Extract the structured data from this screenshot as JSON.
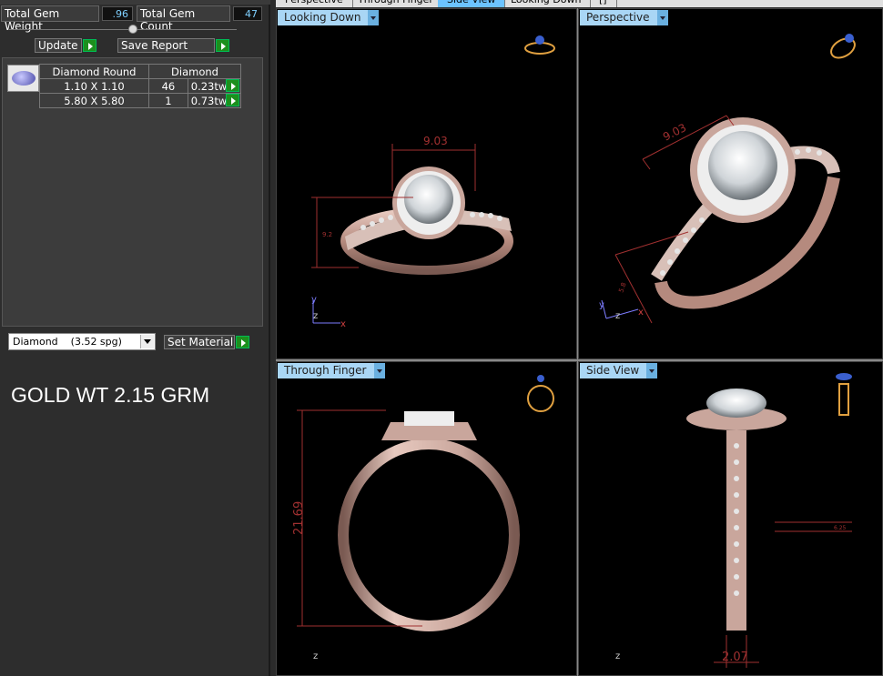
{
  "stats": {
    "total_gem_weight_label": "Total Gem Weight",
    "total_gem_weight_value": ".96",
    "total_gem_count_label": "Total Gem Count",
    "total_gem_count_value": "47"
  },
  "buttons": {
    "update": "Update",
    "save_report": "Save Report",
    "set_material": "Set Material"
  },
  "gem_table": {
    "headers": [
      "Diamond Round",
      "Diamond"
    ],
    "rows": [
      {
        "size": "1.10 X 1.10",
        "count": "46",
        "weight": "0.23tw"
      },
      {
        "size": "5.80 X 5.80",
        "count": "1",
        "weight": "0.73tw"
      }
    ]
  },
  "material": {
    "selected": "Diamond    (3.52 spg)"
  },
  "gold_weight": "GOLD WT 2.15 GRM",
  "tabs": [
    "Perspective",
    "Through Finger",
    "Side View",
    "Looking Down",
    "[]"
  ],
  "viewports": {
    "top_left": {
      "title": "Looking Down",
      "dim_top": "9.03",
      "dim_side": "9.2"
    },
    "top_right": {
      "title": "Perspective",
      "dim_top": "9.03",
      "dim_side": "5.8"
    },
    "bottom_left": {
      "title": "Through Finger",
      "dim_side": "21.69"
    },
    "bottom_right": {
      "title": "Side View",
      "dim_bottom": "2.07",
      "dim_side": "6.25"
    }
  },
  "axes": {
    "x": "x",
    "y": "y",
    "z": "z"
  },
  "colors": {
    "accent": "#6cc3ff",
    "metal": "#c9a69c",
    "dimension": "#a03030",
    "green": "#1d8f1d"
  }
}
